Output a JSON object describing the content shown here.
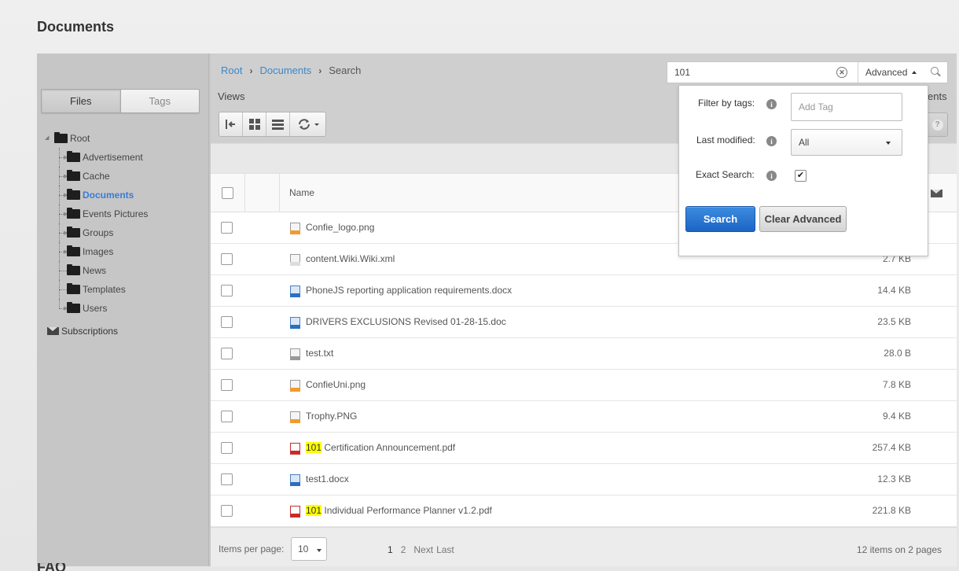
{
  "page": {
    "title": "Documents",
    "footer_stub": "FAQ"
  },
  "sidebar": {
    "tabs": [
      {
        "label": "Files",
        "active": true
      },
      {
        "label": "Tags",
        "active": false
      }
    ],
    "tree": {
      "root": "Root",
      "children": [
        {
          "label": "Advertisement",
          "expandable": true
        },
        {
          "label": "Cache",
          "expandable": true
        },
        {
          "label": "Documents",
          "expandable": true,
          "selected": true
        },
        {
          "label": "Events Pictures",
          "expandable": true
        },
        {
          "label": "Groups",
          "expandable": true
        },
        {
          "label": "Images",
          "expandable": true
        },
        {
          "label": "News",
          "expandable": false
        },
        {
          "label": "Templates",
          "expandable": false
        },
        {
          "label": "Users",
          "expandable": true
        }
      ]
    },
    "subscriptions": "Subscriptions"
  },
  "breadcrumb": {
    "root": "Root",
    "parent": "Documents",
    "current": "Search"
  },
  "views": {
    "label": "Views",
    "partial_right_label": "ents"
  },
  "search": {
    "query": "101",
    "advanced_label": "Advanced"
  },
  "advanced": {
    "filter_tags_label": "Filter by tags:",
    "tag_placeholder": "Add Tag",
    "last_modified_label": "Last modified:",
    "last_modified_value": "All",
    "exact_label": "Exact Search:",
    "exact_checked": true,
    "search_button": "Search",
    "clear_button": "Clear Advanced"
  },
  "grid": {
    "name_header": "Name",
    "rows": [
      {
        "prefix": "",
        "highlight": "",
        "name": "Confie_logo.png",
        "size": "",
        "type": "png"
      },
      {
        "prefix": "",
        "highlight": "",
        "name": "content.Wiki.Wiki.xml",
        "size": "2.7 KB",
        "type": "xml"
      },
      {
        "prefix": "",
        "highlight": "",
        "name": "PhoneJS reporting application requirements.docx",
        "size": "14.4 KB",
        "type": "doc"
      },
      {
        "prefix": "",
        "highlight": "",
        "name": "DRIVERS EXCLUSIONS Revised 01-28-15.doc",
        "size": "23.5 KB",
        "type": "doc"
      },
      {
        "prefix": "",
        "highlight": "",
        "name": "test.txt",
        "size": "28.0 B",
        "type": "txt"
      },
      {
        "prefix": "",
        "highlight": "",
        "name": "ConfieUni.png",
        "size": "7.8 KB",
        "type": "png"
      },
      {
        "prefix": "",
        "highlight": "",
        "name": "Trophy.PNG",
        "size": "9.4 KB",
        "type": "png"
      },
      {
        "prefix": "",
        "highlight": "101",
        "name": " Certification Announcement.pdf",
        "size": "257.4 KB",
        "type": "pdf"
      },
      {
        "prefix": "",
        "highlight": "",
        "name": "test1.docx",
        "size": "12.3 KB",
        "type": "doc"
      },
      {
        "prefix": "",
        "highlight": "101",
        "name": " Individual Performance Planner v1.2.pdf",
        "size": "221.8 KB",
        "type": "pdf"
      }
    ]
  },
  "pager": {
    "items_per_page_label": "Items per page:",
    "items_per_page": "10",
    "pages": [
      "1",
      "2"
    ],
    "next": "Next",
    "last": "Last",
    "info": "12 items on 2 pages"
  }
}
